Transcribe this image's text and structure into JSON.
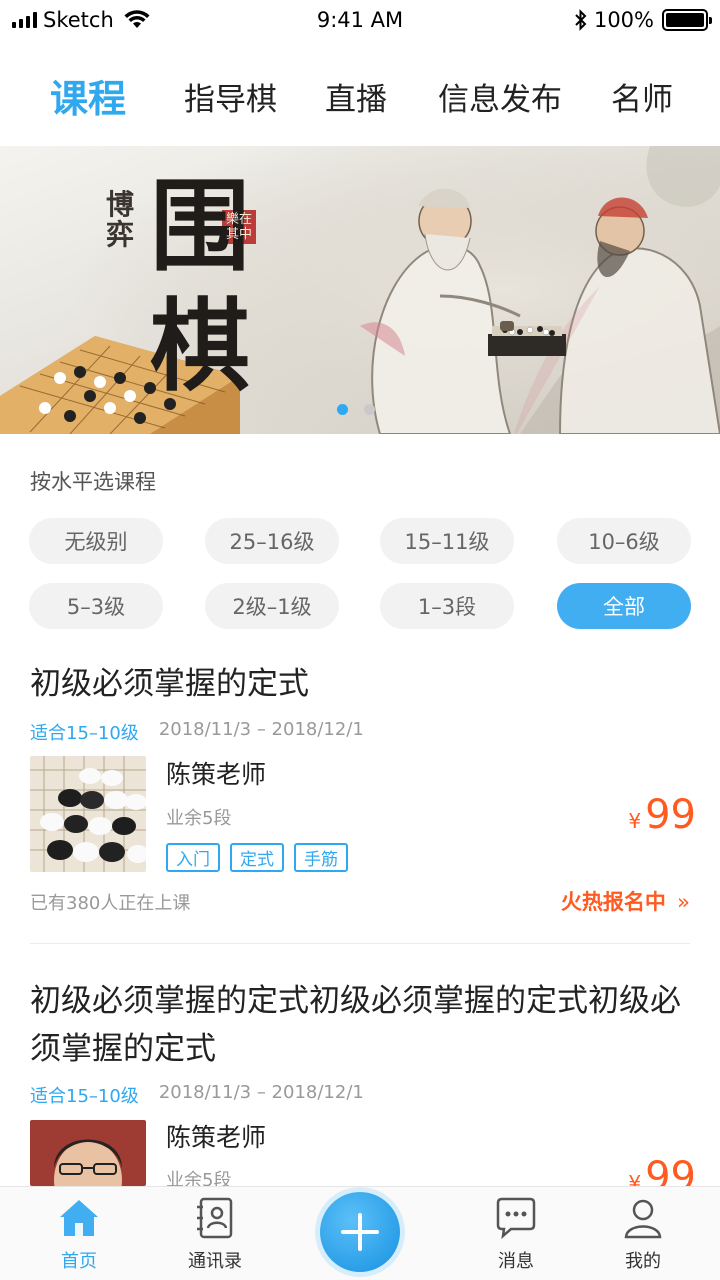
{
  "status_bar": {
    "carrier": "Sketch",
    "time": "9:41 AM",
    "battery": "100%"
  },
  "top_tabs": [
    {
      "label": "课程",
      "active": true
    },
    {
      "label": "指导棋",
      "active": false
    },
    {
      "label": "直播",
      "active": false
    },
    {
      "label": "信息发布",
      "active": false
    },
    {
      "label": "名师",
      "active": false
    }
  ],
  "banner": {
    "calligraphy_small": "博弈",
    "calligraphy_big": "围棋",
    "seal_text": "樂在其中",
    "slide_count": 2,
    "active_slide": 1
  },
  "filter": {
    "label": "按水平选课程",
    "levels": [
      {
        "label": "无级别",
        "active": false
      },
      {
        "label": "25–16级",
        "active": false
      },
      {
        "label": "15–11级",
        "active": false
      },
      {
        "label": "10–6级",
        "active": false
      },
      {
        "label": "5–3级",
        "active": false
      },
      {
        "label": "2级–1级",
        "active": false
      },
      {
        "label": "1–3段",
        "active": false
      },
      {
        "label": "全部",
        "active": true
      }
    ]
  },
  "courses": [
    {
      "title": "初级必须掌握的定式",
      "suitable": "适合15–10级",
      "dates": "2018/11/3 – 2018/12/1",
      "teacher": "陈策老师",
      "rank": "业余5段",
      "tags": [
        "入门",
        "定式",
        "手筋"
      ],
      "currency": "¥",
      "price": "99",
      "enrolled": "已有380人正在上课",
      "status": "火热报名中"
    },
    {
      "title": "初级必须掌握的定式初级必须掌握的定式初级必须掌握的定式",
      "suitable": "适合15–10级",
      "dates": "2018/11/3 – 2018/12/1",
      "teacher": "陈策老师",
      "rank": "业余5段",
      "currency": "¥",
      "price": "99"
    }
  ],
  "bottom_tabs": [
    {
      "label": "首页",
      "icon": "home-icon",
      "active": true
    },
    {
      "label": "通讯录",
      "icon": "contacts-icon",
      "active": false
    },
    {
      "label": "",
      "icon": "plus-icon",
      "active": false
    },
    {
      "label": "消息",
      "icon": "message-icon",
      "active": false
    },
    {
      "label": "我的",
      "icon": "profile-icon",
      "active": false
    }
  ],
  "colors": {
    "accent": "#2fa8f0",
    "price": "#ff5a1f"
  }
}
